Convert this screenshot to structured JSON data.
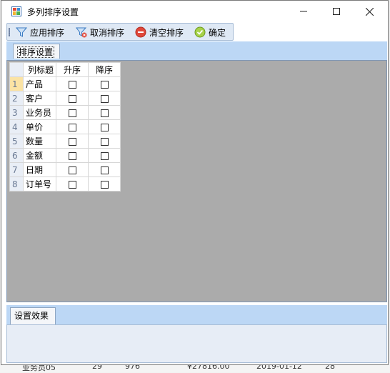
{
  "window": {
    "title": "多列排序设置",
    "minimize_glyph": "—",
    "maximize_glyph": "☐",
    "close_glyph": "✕"
  },
  "toolbar": {
    "apply_sort": "应用排序",
    "cancel_sort": "取消排序",
    "clear_sort": "清空排序",
    "confirm": "确定"
  },
  "tabs": {
    "top": "排序设置",
    "bottom": "设置效果"
  },
  "grid": {
    "headers": [
      "列标题",
      "升序",
      "降序"
    ],
    "rows": [
      {
        "num": "1",
        "title": "产品"
      },
      {
        "num": "2",
        "title": "客户"
      },
      {
        "num": "3",
        "title": "业务员"
      },
      {
        "num": "4",
        "title": "单价"
      },
      {
        "num": "5",
        "title": "数量"
      },
      {
        "num": "6",
        "title": "金额"
      },
      {
        "num": "7",
        "title": "日期"
      },
      {
        "num": "8",
        "title": "订单号"
      }
    ]
  },
  "background_row": {
    "cells": [
      "业务员05",
      "29",
      "976",
      "¥27816.00",
      "2019-01-12",
      "28"
    ]
  },
  "colors": {
    "toolbar_bg": "#dfe9f5",
    "tabstrip_bg": "#bcd7f5",
    "grid_area_bg": "#ababab",
    "selected_row_header": "#fbe3a4"
  }
}
